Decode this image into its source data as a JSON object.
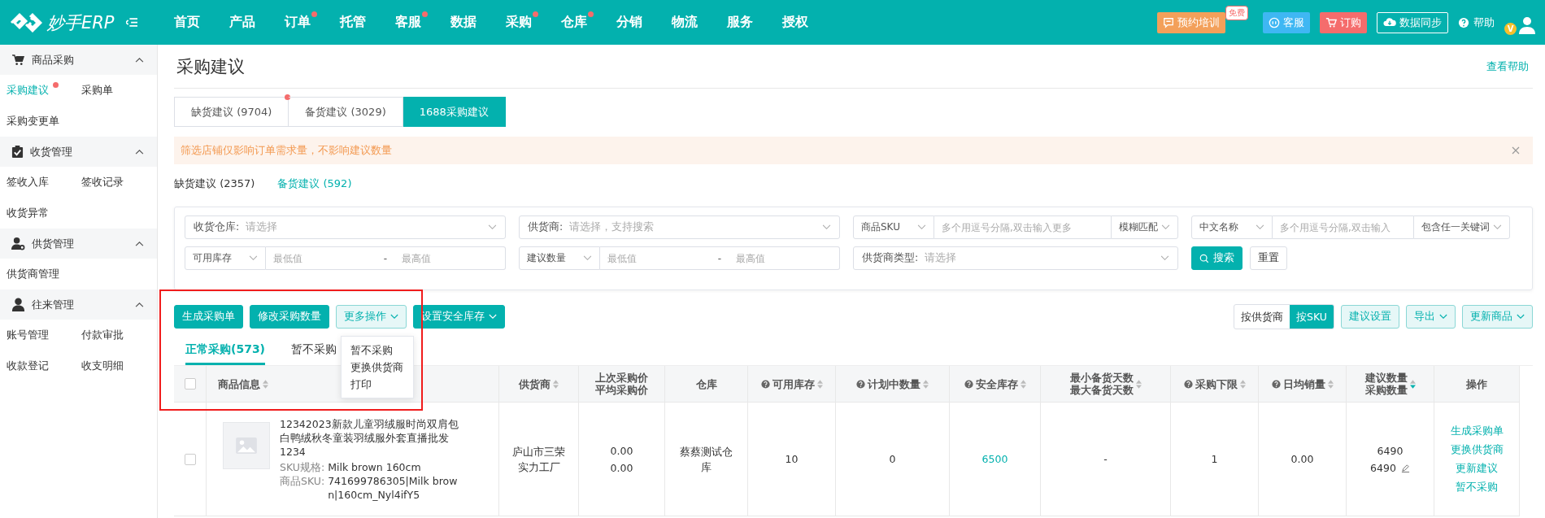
{
  "brand": {
    "logo_text": "妙手ERP"
  },
  "nav": [
    {
      "label": "首页",
      "dot": false
    },
    {
      "label": "产品",
      "dot": false
    },
    {
      "label": "订单",
      "dot": true
    },
    {
      "label": "托管",
      "dot": false
    },
    {
      "label": "客服",
      "dot": true
    },
    {
      "label": "数据",
      "dot": false
    },
    {
      "label": "采购",
      "dot": true
    },
    {
      "label": "仓库",
      "dot": true
    },
    {
      "label": "分销",
      "dot": false
    },
    {
      "label": "物流",
      "dot": false
    },
    {
      "label": "服务",
      "dot": false
    },
    {
      "label": "授权",
      "dot": false
    }
  ],
  "header_actions": [
    {
      "kind": "training",
      "label": "预约培训",
      "badge": "免费"
    },
    {
      "kind": "service",
      "label": "客服"
    },
    {
      "kind": "order",
      "label": "订购"
    },
    {
      "kind": "sync",
      "label": "数据同步"
    },
    {
      "kind": "help",
      "label": "帮助"
    }
  ],
  "avatar": {
    "badge": "V"
  },
  "sidebar": [
    {
      "kind": "cart",
      "title": "商品采购",
      "expanded": true,
      "items": [
        {
          "label": "采购建议",
          "selected": true,
          "dot": true
        },
        {
          "label": "采购单",
          "selected": false,
          "dot": false
        },
        {
          "label": "采购变更单",
          "selected": false,
          "dot": false
        }
      ]
    },
    {
      "kind": "clipboard",
      "title": "收货管理",
      "expanded": true,
      "items": [
        {
          "label": "签收入库",
          "selected": false,
          "dot": false
        },
        {
          "label": "签收记录",
          "selected": false,
          "dot": false
        },
        {
          "label": "收货异常",
          "selected": false,
          "dot": false
        }
      ]
    },
    {
      "kind": "supplier",
      "title": "供货管理",
      "expanded": true,
      "items": [
        {
          "label": "供货商管理",
          "selected": false,
          "dot": false
        }
      ]
    },
    {
      "kind": "person",
      "title": "往来管理",
      "expanded": true,
      "items": [
        {
          "label": "账号管理",
          "selected": false,
          "dot": false
        },
        {
          "label": "付款审批",
          "selected": false,
          "dot": false
        },
        {
          "label": "收款登记",
          "selected": false,
          "dot": false
        },
        {
          "label": "收支明细",
          "selected": false,
          "dot": false
        }
      ]
    }
  ],
  "page": {
    "title": "采购建议",
    "help_link": "查看帮助"
  },
  "main_tabs": [
    {
      "label": "缺货建议 (9704)",
      "selected": false,
      "dot": true
    },
    {
      "label": "备货建议 (3029)",
      "selected": false,
      "dot": false
    },
    {
      "label": "1688采购建议",
      "selected": true,
      "dot": false
    }
  ],
  "alert": {
    "text": "筛选店铺仅影响订单需求量，不影响建议数量"
  },
  "sub_tabs": [
    {
      "label": "缺货建议 (2357)",
      "selected": false
    },
    {
      "label": "备货建议 (592)",
      "selected": true
    }
  ],
  "filters": [
    {
      "kind": "select",
      "label": "收货仓库:",
      "placeholder": "请选择"
    },
    {
      "kind": "select",
      "label": "供货商:",
      "placeholder": "请选择，支持搜索"
    },
    {
      "kind": "keyword",
      "label": "商品SKU",
      "placeholder": "多个用逗号分隔,双击输入更多",
      "match": "模糊匹配"
    },
    {
      "kind": "keyword",
      "label": "中文名称",
      "placeholder": "多个用逗号分隔,双击输入",
      "match": "包含任一关键词"
    },
    {
      "kind": "range",
      "label": "可用库存",
      "min_placeholder": "最低值",
      "separator": "-",
      "max_placeholder": "最高值"
    },
    {
      "kind": "range",
      "label": "建议数量",
      "min_placeholder": "最低值",
      "separator": "-",
      "max_placeholder": "最高值"
    },
    {
      "kind": "select",
      "label": "供货商类型:",
      "placeholder": "请选择"
    }
  ],
  "filter_buttons": [
    {
      "kind": "primary",
      "label": "搜索"
    },
    {
      "kind": "plain",
      "label": "重置"
    }
  ],
  "toolbar": [
    {
      "kind": "primary",
      "label": "生成采购单",
      "caret": false
    },
    {
      "kind": "primary",
      "label": "修改采购数量",
      "caret": false
    },
    {
      "kind": "light",
      "label": "更多操作",
      "caret": true,
      "open": true
    },
    {
      "kind": "primary",
      "label": "设置安全库存",
      "caret": true
    }
  ],
  "dropdown": [
    "暂不采购",
    "更换供货商",
    "打印"
  ],
  "highlight_frame": true,
  "view_toggle": [
    {
      "label": "按供货商",
      "selected": false
    },
    {
      "label": "按SKU",
      "selected": true
    }
  ],
  "toolbar_right": [
    {
      "label": "建议设置",
      "caret": false
    },
    {
      "label": "导出",
      "caret": true
    },
    {
      "label": "更新商品",
      "caret": true
    }
  ],
  "list_tabs": [
    {
      "label": "正常采购(573)",
      "selected": true
    },
    {
      "label": "暂不采购",
      "selected": false
    }
  ],
  "table": {
    "all_checked": false,
    "columns": [
      {
        "lines": [
          "商品信息"
        ],
        "help": false,
        "sortable": true,
        "sorted_desc": false
      },
      {
        "lines": [
          "供货商"
        ],
        "help": false,
        "sortable": true,
        "sorted_desc": false
      },
      {
        "lines": [
          "上次采购价",
          "平均采购价"
        ],
        "help": false,
        "sortable": false
      },
      {
        "lines": [
          "仓库"
        ],
        "help": false,
        "sortable": false
      },
      {
        "lines": [
          "可用库存"
        ],
        "help": true,
        "sortable": true,
        "sorted_desc": false
      },
      {
        "lines": [
          "计划中数量"
        ],
        "help": true,
        "sortable": true,
        "sorted_desc": false
      },
      {
        "lines": [
          "安全库存"
        ],
        "help": true,
        "sortable": true,
        "sorted_desc": false
      },
      {
        "lines": [
          "最小备货天数",
          "最大备货天数"
        ],
        "help": false,
        "sortable": true,
        "sorted_desc": false
      },
      {
        "lines": [
          "采购下限"
        ],
        "help": true,
        "sortable": true,
        "sorted_desc": false
      },
      {
        "lines": [
          "日均销量"
        ],
        "help": true,
        "sortable": true,
        "sorted_desc": false
      },
      {
        "lines": [
          "建议数量",
          "采购数量"
        ],
        "help": false,
        "sortable": true,
        "sorted_desc": true
      },
      {
        "lines": [
          "操作"
        ],
        "help": false,
        "sortable": false
      }
    ],
    "rows": [
      {
        "checked": false,
        "title": "12342023新款儿童羽绒服时尚双肩包白鸭绒秋冬童装羽绒服外套直播批发1234",
        "spec_label": "SKU规格:",
        "spec_value": "Milk brown 160cm",
        "sku_label": "商品SKU:",
        "sku_value": "741699786305|Milk brown|160cm_Nyl4ifY5",
        "supplier": "庐山市三荣实力工厂",
        "last_price": "0.00",
        "avg_price": "0.00",
        "warehouse": "蔡蔡测试仓库",
        "available": "10",
        "planned": "0",
        "safety_stock": "6500",
        "days": "-",
        "min_purchase": "1",
        "daily_sales": "0.00",
        "suggested_qty": "6490",
        "purchase_qty": "6490",
        "actions": [
          "生成采购单",
          "更换供货商",
          "更新建议",
          "暂不采购"
        ]
      }
    ]
  }
}
